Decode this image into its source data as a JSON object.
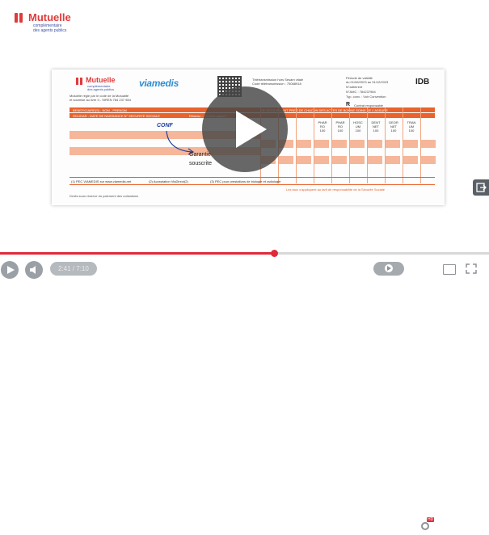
{
  "brand": {
    "name": "Mutuelle",
    "sub1": "complémentaire",
    "sub2": "des agents publics",
    "color": "#e03a3a",
    "sub_color": "#3a4fa0"
  },
  "card": {
    "logo_name": "Mutuelle",
    "logo_sub1": "complémentaire",
    "logo_sub2": "des agents publics",
    "partner": "viamedis",
    "org_line1": "Mutuelle régie par le code de la Mutualité",
    "org_line2": "et soumise au livre II - SIREN 784 237 984",
    "tele_line1": "Télétransmission hors Sesam vitale",
    "tele_line2": "Code télétransmission : 75068918",
    "validity_line1": "Période de validité",
    "validity_line2": "du 01/06/2023 au 31/12/2023",
    "adherent": "N°adhérent",
    "amc": "N°AMC : 784237984",
    "conv": "Typ. conv. : Voir Convention",
    "idb": "IDB",
    "r_letter": "R",
    "contrat": "Contrat responsable",
    "header_left1": "BENEFICIAIRE(S) : NOM - PRENOM",
    "header_left2": "SOLIDAR - DATE DE NAISSANCE    N° SECURITE SOCIALE",
    "header_right": "Réseau ... en tiers payant",
    "header_right2": "EN TIERS PAYANT PRES DE CHACUN DES ACTES DE BONNE SOINS DE L'ASSURE",
    "columns": [
      {
        "code": "PHAR",
        "l2": "RO",
        "l3": "100"
      },
      {
        "code": "PHAR",
        "l2": "RO",
        "l3": "100"
      },
      {
        "code": "HOSC",
        "l2": "UM",
        "l3": "100"
      },
      {
        "code": "DENT",
        "l2": "NET",
        "l3": "100"
      },
      {
        "code": "DEOR",
        "l2": "NET",
        "l3": "100"
      },
      {
        "code": "TRAN",
        "l2": "UM",
        "l3": "100"
      }
    ],
    "conf": "CONF",
    "guarantee_1": "Garantie",
    "guarantee_2": "souscrite",
    "footer_1": "(1) PEC VIAMEDIS sur www.viamedis.net",
    "footer_2": "(2) Acceptation ViaDirect(2)",
    "footer_3": "(3) PEC pour prestations de biologie et radiologie",
    "note_1": "Les taux s'appliquent au tarif de responsabilité de la Sécurité Sociale",
    "note_2": "Droits sous réserve du paiement des cotisations",
    "orange": "#e8632d"
  },
  "player": {
    "time": "2:41 / 7:10",
    "progress": 0.56,
    "accent": "#e02a3a",
    "hd_label": "HD",
    "icons": [
      "play-icon",
      "volume-icon",
      "captions-icon",
      "settings-icon",
      "theater-icon",
      "fullscreen-icon"
    ]
  }
}
